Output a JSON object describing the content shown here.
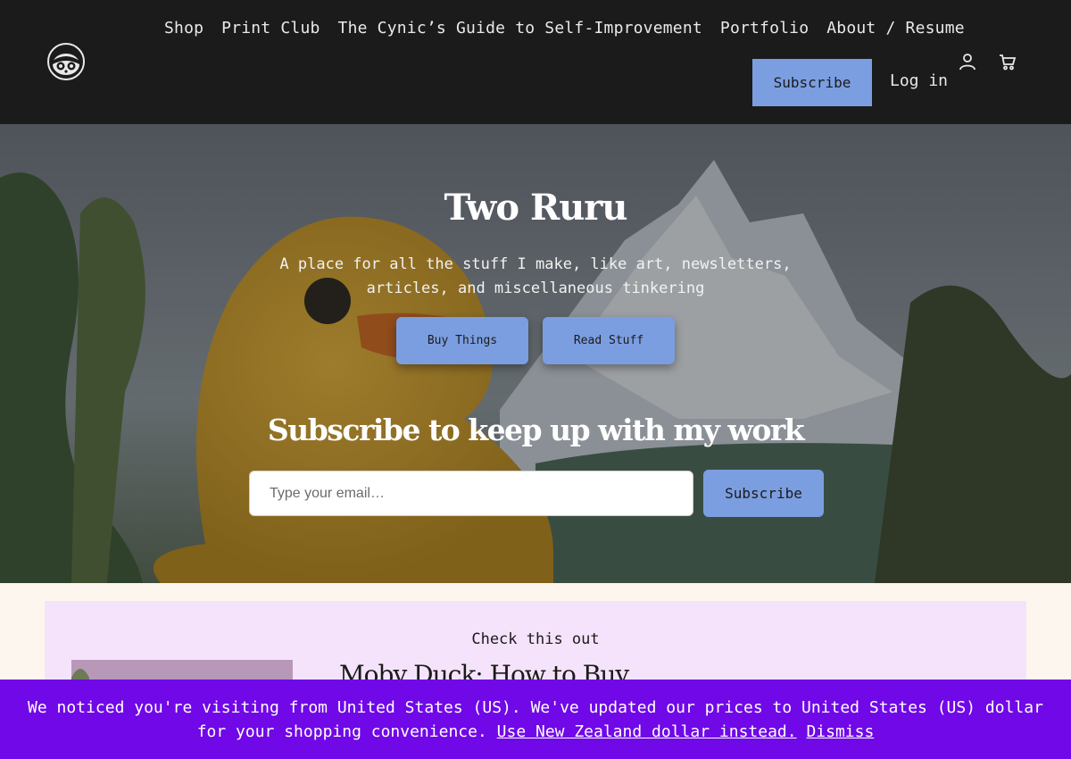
{
  "header": {
    "nav": [
      {
        "label": "Shop"
      },
      {
        "label": "Print Club"
      },
      {
        "label": "The Cynic’s Guide to Self-Improvement"
      },
      {
        "label": "Portfolio"
      },
      {
        "label": "About / Resume"
      }
    ],
    "subscribe_label": "Subscribe",
    "login_label": "Log in",
    "icons": {
      "logo": "raccoon-logo",
      "account": "user-icon",
      "cart": "cart-icon"
    }
  },
  "hero": {
    "title": "Two Ruru",
    "subtitle": "A place for all the stuff I make, like art, newsletters, articles, and miscellaneous tinkering",
    "buy_label": "Buy Things",
    "read_label": "Read Stuff",
    "subscribe_heading": "Subscribe to keep up with my work",
    "email_placeholder": "Type your email…",
    "subscribe_label": "Subscribe"
  },
  "featured": {
    "label": "Check this out",
    "title": "Moby Duck: How to Buy"
  },
  "banner": {
    "message": "We noticed you're visiting from United States (US). We've updated our prices to United States (US) dollar for your shopping convenience.",
    "nzd_link": "Use New Zealand dollar instead.",
    "dismiss_link": "Dismiss"
  },
  "colors": {
    "header_bg": "#1b1b1b",
    "accent_button": "#7b9ee0",
    "featured_bg": "#f5e3fb",
    "banner_bg": "#7008e7",
    "page_bg": "#fdf6ef"
  }
}
